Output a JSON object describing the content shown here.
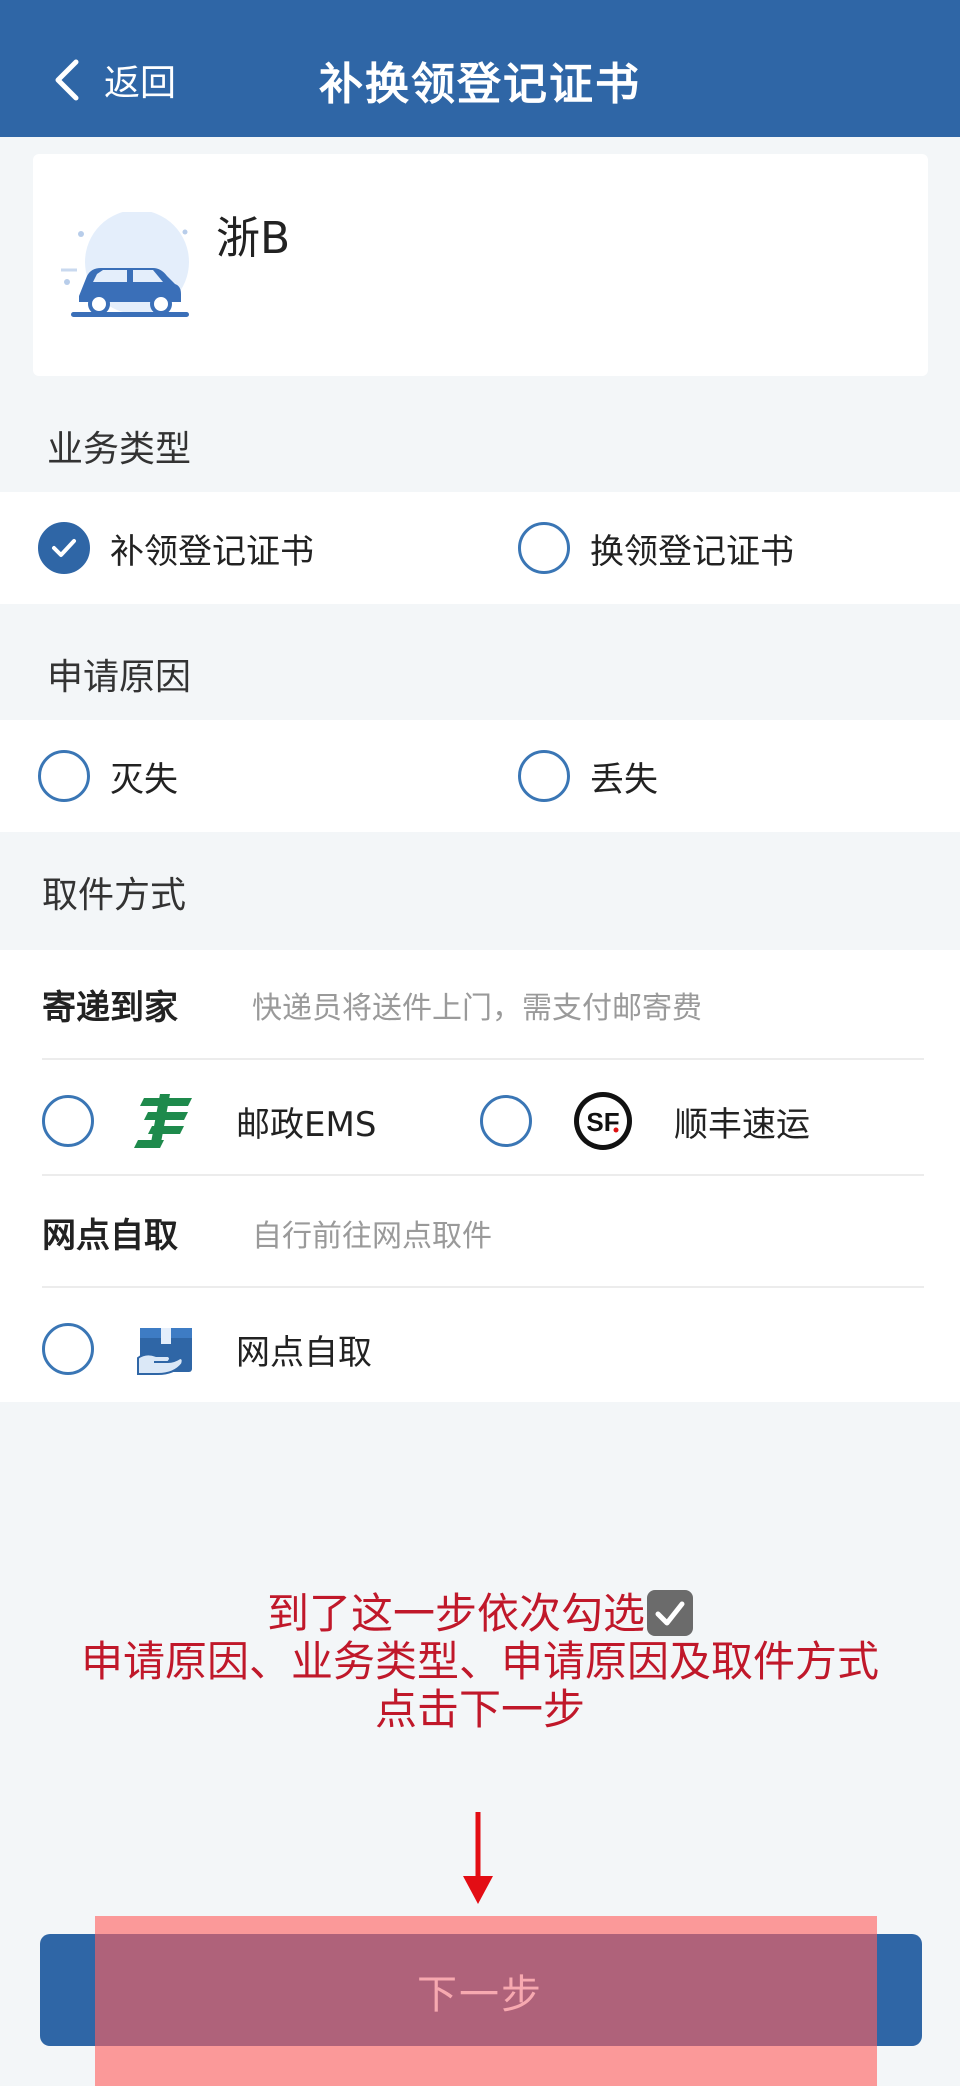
{
  "header": {
    "back_label": "返回",
    "title": "补换领登记证书"
  },
  "vehicle": {
    "plate": "浙B",
    "icon": "car-icon"
  },
  "business_type": {
    "label": "业务类型",
    "options": [
      {
        "label": "补领登记证书",
        "checked": true
      },
      {
        "label": "换领登记证书",
        "checked": false
      }
    ]
  },
  "reason": {
    "label": "申请原因",
    "options": [
      {
        "label": "灭失",
        "checked": false
      },
      {
        "label": "丢失",
        "checked": false
      }
    ]
  },
  "pickup": {
    "label": "取件方式",
    "delivery": {
      "title": "寄递到家",
      "desc": "快递员将送件上门，需支付邮寄费",
      "options": [
        {
          "label": "邮政EMS",
          "icon": "china-post-icon",
          "checked": false
        },
        {
          "label": "顺丰速运",
          "icon": "sf-express-icon",
          "checked": false
        }
      ]
    },
    "self_pickup": {
      "title": "网点自取",
      "desc": "自行前往网点取件",
      "options": [
        {
          "label": "网点自取",
          "icon": "pickup-box-icon",
          "checked": false
        }
      ]
    }
  },
  "annotation": {
    "line1": "到了这一步依次勾选",
    "line2": "申请原因、业务类型、申请原因及取件方式",
    "line3": "点击下一步"
  },
  "next_button": {
    "label": "下一步"
  },
  "colors": {
    "header": "#2f66a6",
    "radio": "#3a76b5",
    "annotation": "#c0182a",
    "ems_green": "#1e8a4c"
  }
}
